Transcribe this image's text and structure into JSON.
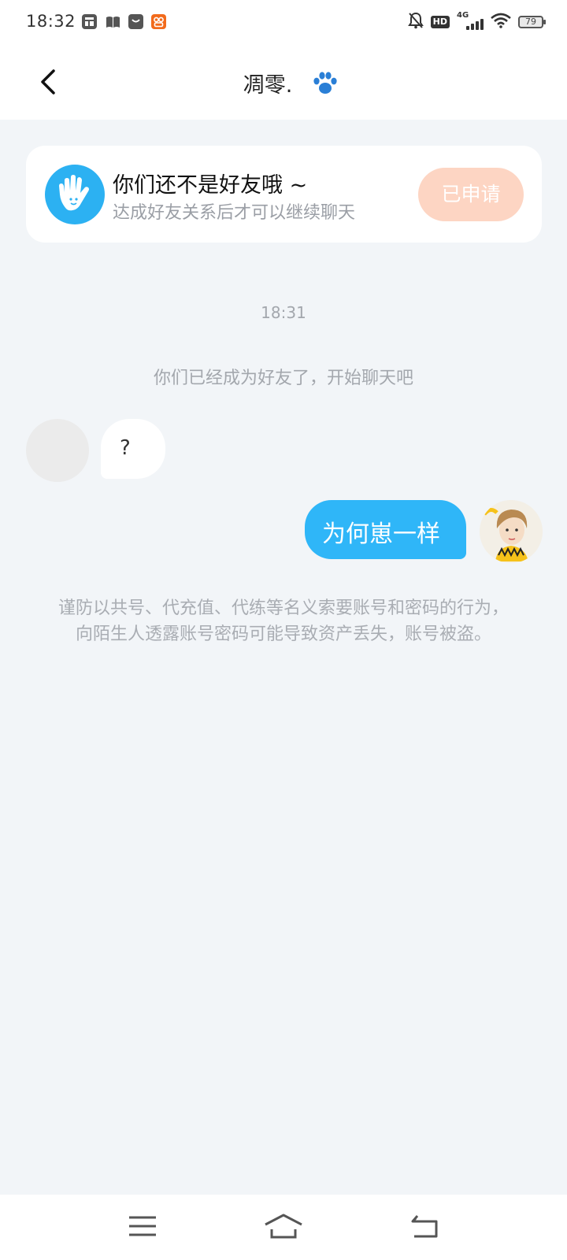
{
  "status_bar": {
    "time": "18:32",
    "app_icons": [
      {
        "name": "notes-app-icon",
        "color": "#555555"
      },
      {
        "name": "book-app-icon",
        "color": "#555555"
      },
      {
        "name": "shopping-bag-app-icon",
        "color": "#555555"
      },
      {
        "name": "orange-app-icon",
        "color": "#f26a1b"
      }
    ],
    "hd_label": "HD",
    "network_label": "4G",
    "battery_level": "79"
  },
  "header": {
    "back_icon": "chevron-left-icon",
    "title": "凋零."
  },
  "friend_card": {
    "title": "你们还不是好友哦 ~",
    "subtitle": "达成好友关系后才可以继续聊天",
    "button_label": "已申请",
    "button_color": "#fdd5c3",
    "avatar_color": "#2cb1f2"
  },
  "chat": {
    "timestamp": "18:31",
    "system_message": "你们已经成为好友了，开始聊天吧",
    "messages": [
      {
        "side": "left",
        "text": "?"
      },
      {
        "side": "right",
        "text": "为何崽一样"
      }
    ],
    "bubble_color_right": "#2fb6f8",
    "warning": "谨防以共号、代充值、代练等名义索要账号和密码的行为，向陌生人透露账号密码可能导致资产丢失，账号被盗。"
  },
  "colors": {
    "background": "#f2f5f8",
    "accent_blue": "#2fb6f8"
  }
}
